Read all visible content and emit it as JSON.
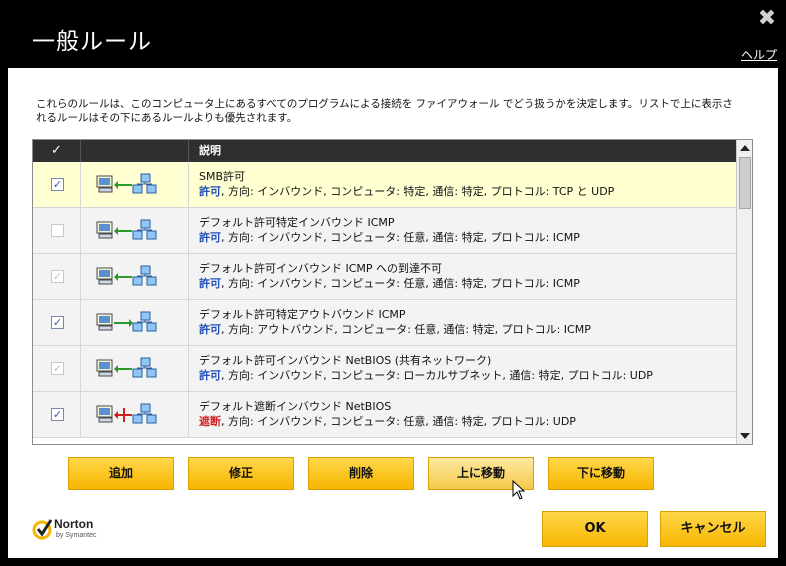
{
  "window": {
    "title": "一般ルール",
    "help_label": "ヘルプ"
  },
  "description": "これらのルールは、このコンピュータ上にあるすべてのプログラムによる接続を ファイアウォール でどう扱うかを決定します。リストで上に表示されるルールはその下にあるルールよりも優先されます。",
  "table": {
    "header": {
      "check_glyph": "✓",
      "description_label": "説明"
    },
    "rows": [
      {
        "checked": true,
        "disabled": false,
        "selected": true,
        "icon": "inbound-allow-icon",
        "title": "SMB許可",
        "action": "許可",
        "action_kind": "allow",
        "detail": ", 方向: インバウンド, コンピュータ: 特定, 通信: 特定, プロトコル: TCP と UDP"
      },
      {
        "checked": false,
        "disabled": true,
        "selected": false,
        "icon": "inbound-allow-icon",
        "title": "デフォルト許可特定インバウンド ICMP",
        "action": "許可",
        "action_kind": "allow",
        "detail": ", 方向: インバウンド, コンピュータ: 任意, 通信: 特定, プロトコル: ICMP"
      },
      {
        "checked": true,
        "disabled": true,
        "selected": false,
        "icon": "inbound-allow-icon",
        "title": "デフォルト許可インバウンド ICMP への到達不可",
        "action": "許可",
        "action_kind": "allow",
        "detail": ", 方向: インバウンド, コンピュータ: 任意, 通信: 特定, プロトコル: ICMP"
      },
      {
        "checked": true,
        "disabled": false,
        "selected": false,
        "icon": "outbound-allow-icon",
        "title": "デフォルト許可特定アウトバウンド ICMP",
        "action": "許可",
        "action_kind": "allow",
        "detail": ", 方向: アウトバウンド, コンピュータ: 任意, 通信: 特定, プロトコル: ICMP"
      },
      {
        "checked": true,
        "disabled": true,
        "selected": false,
        "icon": "inbound-allow-icon",
        "title": "デフォルト許可インバウンド NetBIOS (共有ネットワーク)",
        "action": "許可",
        "action_kind": "allow",
        "detail": ", 方向: インバウンド, コンピュータ: ローカルサブネット, 通信: 特定, プロトコル: UDP"
      },
      {
        "checked": true,
        "disabled": false,
        "selected": false,
        "icon": "inbound-block-icon",
        "title": "デフォルト遮断インバウンド NetBIOS",
        "action": "遮断",
        "action_kind": "block",
        "detail": ", 方向: インバウンド, コンピュータ: 任意, 通信: 特定, プロトコル: UDP"
      }
    ]
  },
  "buttons": {
    "add": "追加",
    "modify": "修正",
    "delete": "削除",
    "move_up": "上に移動",
    "move_down": "下に移動",
    "ok": "OK",
    "cancel": "キャンセル"
  },
  "brand": {
    "name": "Norton",
    "sub": "by Symantec"
  },
  "colors": {
    "accent": "#f7b500",
    "allow": "#1f4fb8",
    "block": "#d41f1f",
    "selected_row": "#ffffd2"
  }
}
